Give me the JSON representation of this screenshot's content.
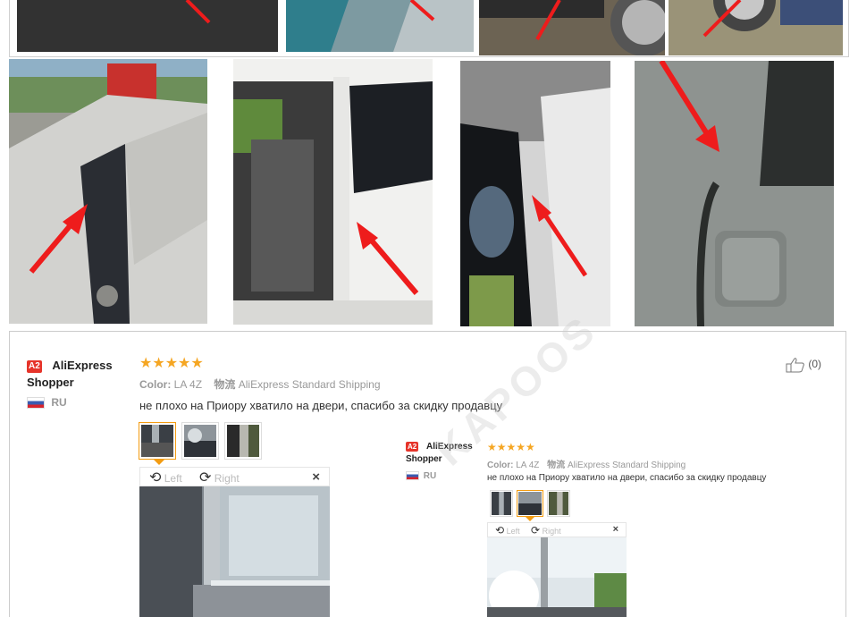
{
  "review": {
    "badge": "A2",
    "username": "AliExpress Shopper",
    "country": "RU",
    "stars": "★★★★★",
    "color_label": "Color:",
    "color_value": "LA 4Z",
    "shipping_label": "物流",
    "shipping_value": "AliExpress Standard Shipping",
    "feedback": "не плохо на Приору хватило на двери, спасибо за скидку продавцу",
    "viewer": {
      "left_label": "Left",
      "right_label": "Right",
      "close": "×"
    },
    "helpful": "(0)"
  },
  "review_inset": {
    "badge": "A2",
    "username_line1": "AliExpress",
    "username_line2": "Shopper",
    "country": "RU",
    "stars": "★★★★★",
    "color_label": "Color:",
    "color_value": "LA 4Z",
    "shipping_label": "物流",
    "shipping_value": "AliExpress Standard Shipping",
    "feedback": "не плохо на Приору хватило на двери, спасибо за скидку продавцу",
    "viewer": {
      "left_label": "Left",
      "right_label": "Right",
      "close": "×"
    }
  },
  "watermark": "KAPOOS",
  "colors": {
    "arrow": "#ee1c1c",
    "star": "#f5a623",
    "badge": "#e6342a",
    "thumb_selected": "#f39c12"
  },
  "icons": [
    "thumbs-up-icon",
    "rotate-left-icon",
    "rotate-right-icon",
    "close-icon",
    "ru-flag-icon",
    "ship-icon"
  ]
}
